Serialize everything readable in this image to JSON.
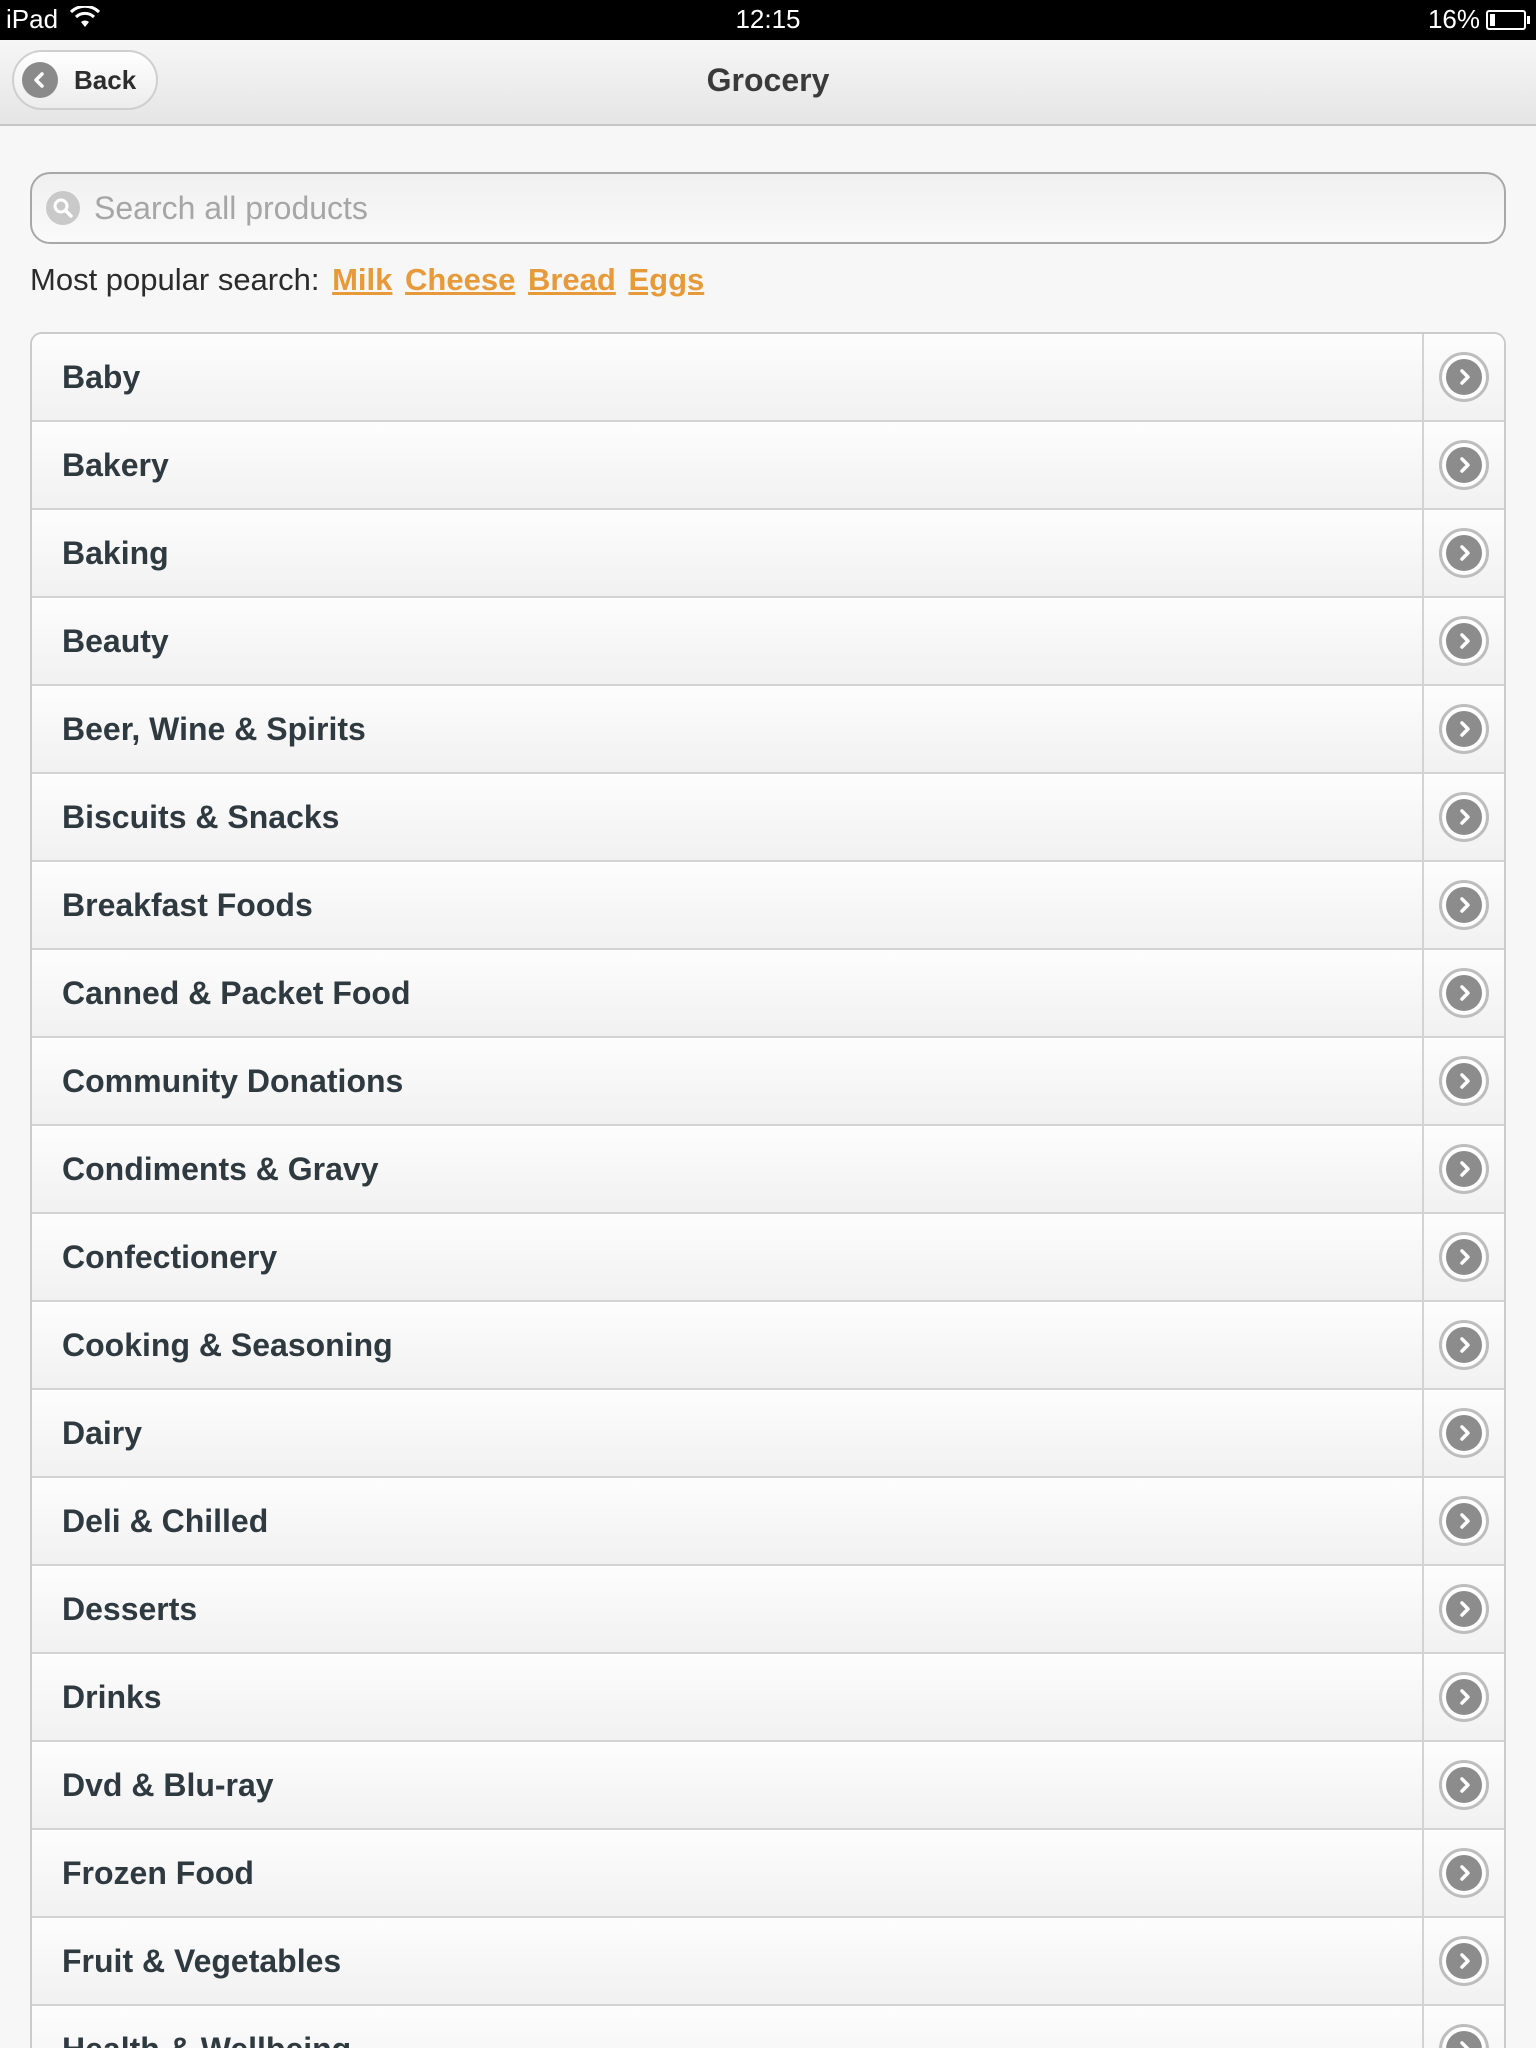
{
  "status_bar": {
    "device": "iPad",
    "time": "12:15",
    "battery": "16%",
    "battery_level": 0.16
  },
  "nav": {
    "back_label": "Back",
    "title": "Grocery"
  },
  "search": {
    "placeholder": "Search all products",
    "value": ""
  },
  "popular": {
    "label": "Most popular search:",
    "terms": [
      "Milk",
      "Cheese",
      "Bread",
      "Eggs"
    ]
  },
  "categories": [
    "Baby",
    "Bakery",
    "Baking",
    "Beauty",
    "Beer, Wine & Spirits",
    "Biscuits & Snacks",
    "Breakfast Foods",
    "Canned & Packet Food",
    "Community Donations",
    "Condiments & Gravy",
    "Confectionery",
    "Cooking & Seasoning",
    "Dairy",
    "Deli & Chilled",
    "Desserts",
    "Drinks",
    "Dvd & Blu-ray",
    "Frozen Food",
    "Fruit & Vegetables",
    "Health & Wellbeing"
  ],
  "colors": {
    "link": "#e69a3a",
    "label_text": "#2f3a40",
    "status_bar": "#000000"
  },
  "icons": {
    "back": "chevron-left-icon",
    "search": "search-icon",
    "row": "chevron-right-circle-icon",
    "wifi": "wifi-icon",
    "battery": "battery-icon"
  }
}
